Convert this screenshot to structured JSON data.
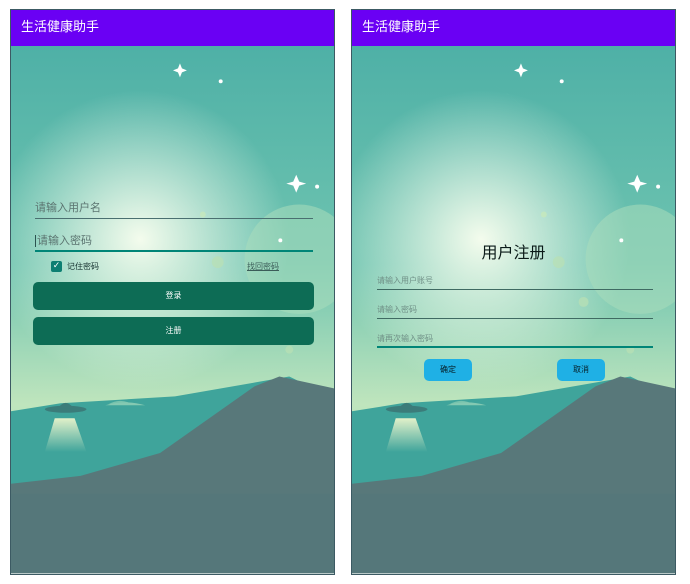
{
  "login_screen": {
    "app_title": "生活健康助手",
    "username_placeholder": "请输入用户名",
    "password_placeholder": "请输入密码",
    "remember_label": "记住密码",
    "remember_checked": true,
    "forgot_label": "找回密码",
    "login_button": "登录",
    "register_button": "注册"
  },
  "register_screen": {
    "app_title": "生活健康助手",
    "title": "用户注册",
    "username_placeholder": "请输入用户账号",
    "password_placeholder": "请输入密码",
    "confirm_placeholder": "请再次输入密码",
    "confirm_button": "确定",
    "cancel_button": "取消"
  },
  "colors": {
    "app_bar": "#6a00f4",
    "primary_button": "#0d6c55",
    "secondary_button": "#1fb0e5",
    "accent": "#008577"
  },
  "icons": [
    "check-icon",
    "star-icon",
    "ufo-icon"
  ]
}
